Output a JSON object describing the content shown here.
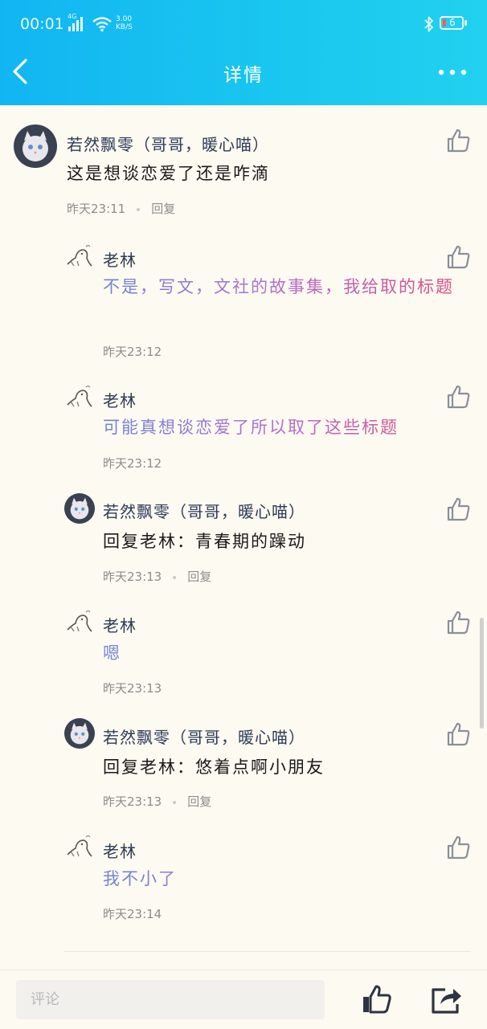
{
  "status_bar": {
    "time": "00:01",
    "network": "4G",
    "speed_value": "3.00",
    "speed_unit": "KB/S",
    "battery": "6"
  },
  "header": {
    "title": "详情"
  },
  "comments": [
    {
      "username": "若然飘零（哥哥，暖心喵）",
      "text": "这是想谈恋爱了还是咋滴",
      "time": "昨天23:11",
      "reply_label": "回复"
    },
    {
      "username": "老林",
      "text": "不是，写文，文社的故事集，我给取的标题",
      "time": "昨天23:12"
    },
    {
      "username": "老林",
      "text": "可能真想谈恋爱了所以取了这些标题",
      "time": "昨天23:12"
    },
    {
      "username": "若然飘零（哥哥，暖心喵）",
      "text": "回复老林：青春期的躁动",
      "time": "昨天23:13",
      "reply_label": "回复"
    },
    {
      "username": "老林",
      "text": "嗯",
      "time": "昨天23:13"
    },
    {
      "username": "若然飘零（哥哥，暖心喵）",
      "text": "回复老林：悠着点啊小朋友",
      "time": "昨天23:13",
      "reply_label": "回复"
    },
    {
      "username": "老林",
      "text": "我不小了",
      "time": "昨天23:14"
    }
  ],
  "bottom_bar": {
    "comment_placeholder": "评论"
  },
  "colors": {
    "header_start": "#12b5f2",
    "header_end": "#22d1ef",
    "background": "#fdfaf1",
    "username": "#2c3b57",
    "gradient_text_start": "#6f84d8",
    "gradient_text_end": "#e0497a"
  },
  "icons": [
    "back-arrow-icon",
    "more-icon",
    "thumbs-up-icon",
    "share-icon",
    "bluetooth-icon",
    "wifi-icon",
    "signal-icon",
    "battery-icon"
  ]
}
